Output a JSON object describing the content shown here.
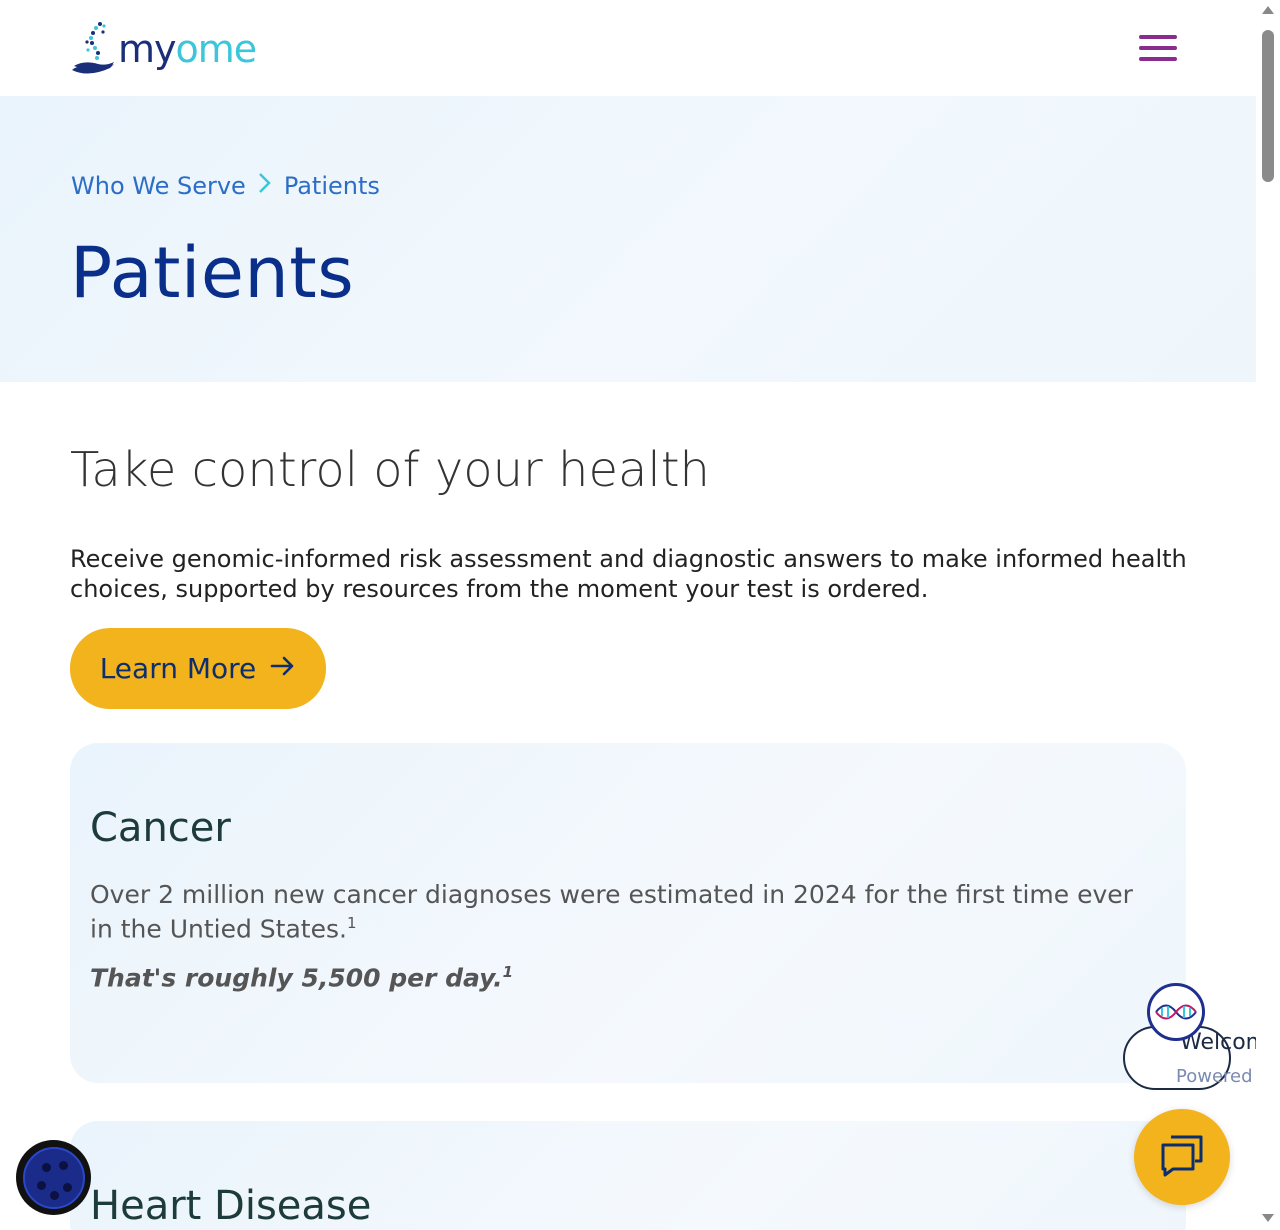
{
  "header": {
    "logo_my": "my",
    "logo_ome": "ome",
    "menu_icon": "hamburger-menu-icon",
    "menu_color": "#8a2c8e"
  },
  "breadcrumb": {
    "parent": "Who We Serve",
    "separator": ">",
    "current": "Patients"
  },
  "hero": {
    "title": "Patients"
  },
  "intro": {
    "heading": "Take control of your health",
    "text": "Receive genomic-informed risk assessment and diagnostic answers to make informed health choices, supported by resources from the moment your test is ordered.",
    "cta_label": "Learn More",
    "cta_icon": "arrow-right-icon",
    "cta_color": "#f2b31c"
  },
  "cards": [
    {
      "title": "Cancer",
      "text": "Over 2 million new cancer diagnoses were estimated in 2024 for the first time ever in the Untied States.",
      "text_sup": "1",
      "emphasis": "That's roughly 5,500 per day.",
      "emphasis_sup": "1"
    },
    {
      "title": "Heart Disease"
    }
  ],
  "chat": {
    "welcome": "Welcom",
    "powered": "Powered",
    "avatar_icon": "dna-avatar-icon",
    "launch_icon": "chat-bubbles-icon"
  },
  "cookie": {
    "icon": "cookie-icon"
  }
}
